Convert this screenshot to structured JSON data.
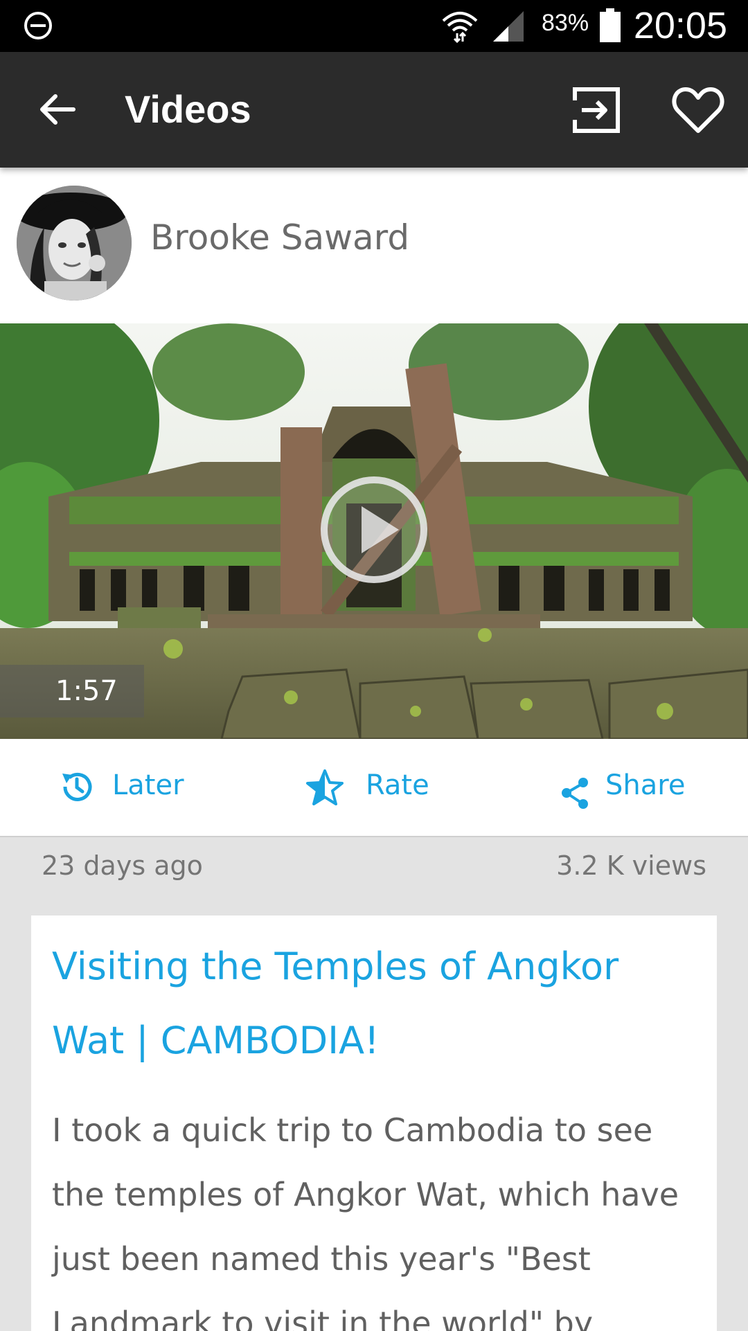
{
  "status_bar": {
    "battery_percent": "83%",
    "time": "20:05",
    "icons": [
      "do-not-disturb-icon",
      "wifi-icon",
      "cell-signal-icon",
      "battery-icon"
    ]
  },
  "app_bar": {
    "title": "Videos",
    "background": "#2b2b2b",
    "icons": [
      "back-arrow-icon",
      "exit-icon",
      "heart-icon"
    ]
  },
  "author": {
    "name": "Brooke Saward"
  },
  "video": {
    "duration": "1:57"
  },
  "actions": [
    {
      "label": "Later",
      "icon": "history-icon"
    },
    {
      "label": "Rate",
      "icon": "star-icon"
    },
    {
      "label": "Share",
      "icon": "share-icon"
    }
  ],
  "meta": {
    "age": "23 days ago",
    "views_number": "3.2",
    "views_unit": "K views"
  },
  "post": {
    "title": "Visiting the Temples of Angkor Wat | CAMBODIA!",
    "description": "I took a quick trip to Cambodia to see the temples of Angkor Wat, which have just been named this year's \"Best Landmark to visit in the world\" by"
  },
  "colors": {
    "accent": "#1aa3e0",
    "page_background": "#e3e3e3"
  }
}
